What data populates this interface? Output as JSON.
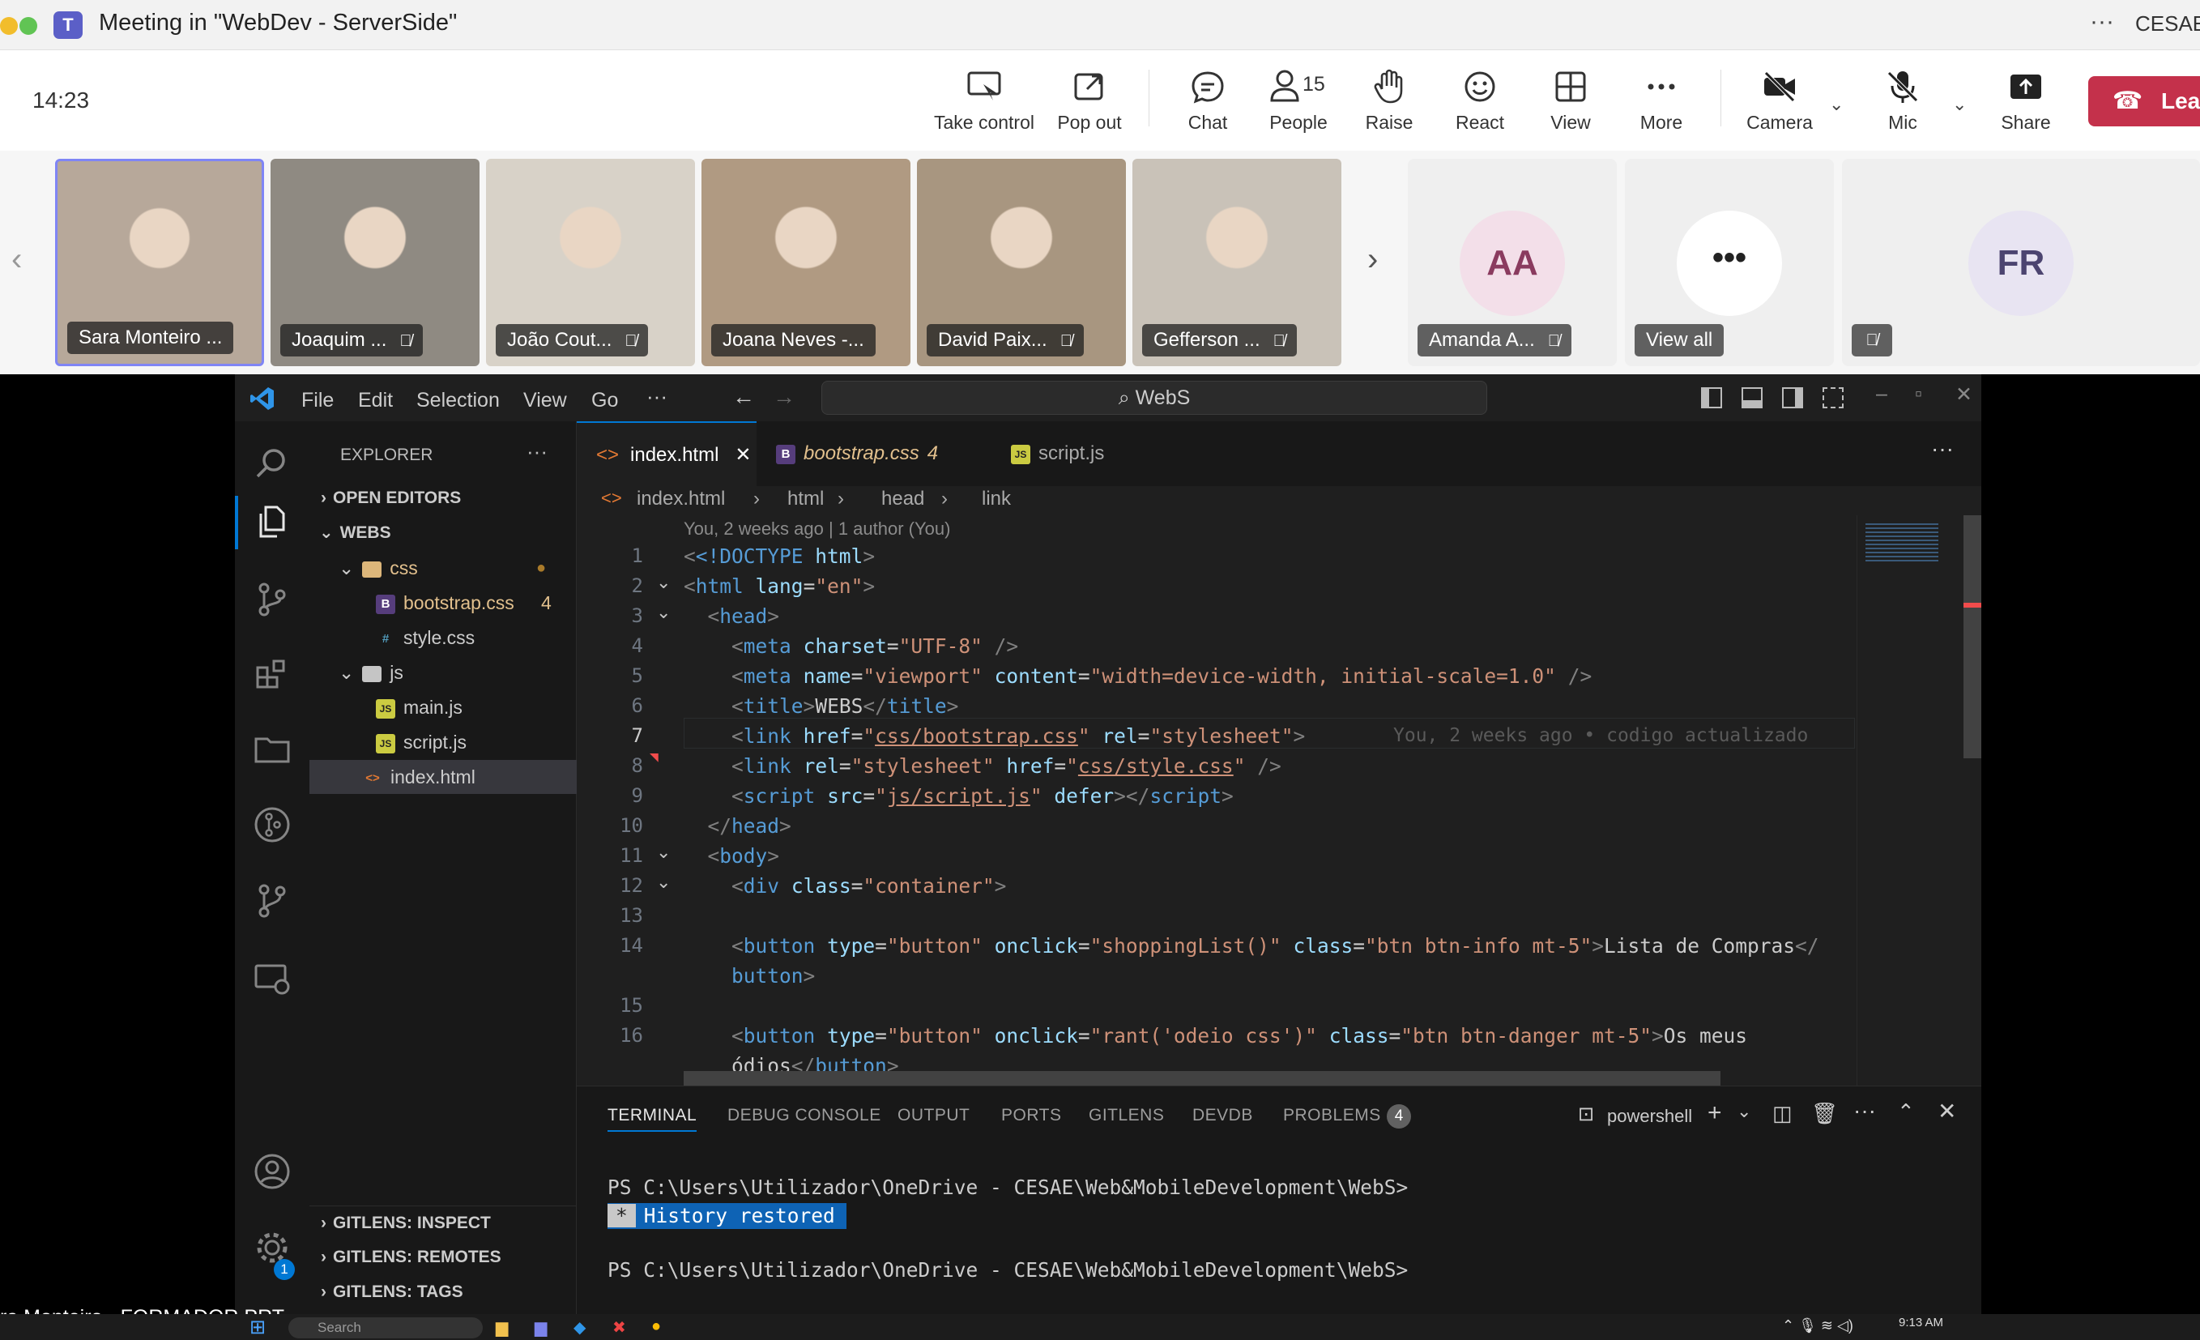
{
  "window": {
    "title": "Meeting in \"WebDev - ServerSide\"",
    "org": "CESAE"
  },
  "toolbar": {
    "time": "14:23",
    "take_control": "Take control",
    "pop_out": "Pop out",
    "chat": "Chat",
    "people": "People",
    "people_count": "15",
    "raise": "Raise",
    "react": "React",
    "view": "View",
    "more": "More",
    "camera": "Camera",
    "mic": "Mic",
    "share": "Share",
    "leave": "Leav"
  },
  "participants": [
    {
      "name": "Sara Monteiro ...",
      "bg": "#b7a89a"
    },
    {
      "name": "Joaquim ...",
      "bg": "#8f8a82"
    },
    {
      "name": "João Cout...",
      "bg": "#d8d2c8"
    },
    {
      "name": "Joana Neves -...",
      "bg": "#b09a82"
    },
    {
      "name": "David Paix...",
      "bg": "#a89680"
    },
    {
      "name": "Gefferson ...",
      "bg": "#c9c2b8"
    }
  ],
  "avatars": [
    {
      "initials": "AA",
      "name": "Amanda A...",
      "bg": "#f3dfe9",
      "fg": "#8a3b5f"
    },
    {
      "initials": "FR",
      "bg": "#e8e4f2",
      "fg": "#4c4470"
    }
  ],
  "view_all": "View all",
  "vscode": {
    "menu": [
      "File",
      "Edit",
      "Selection",
      "View",
      "Go"
    ],
    "search": "WebS",
    "explorer": {
      "title": "EXPLORER",
      "open_editors": "OPEN EDITORS",
      "workspace": "WEBS",
      "items": [
        {
          "label": "css",
          "kind": "folder"
        },
        {
          "label": "bootstrap.css",
          "badge": "4",
          "kind": "B"
        },
        {
          "label": "style.css",
          "kind": "#"
        },
        {
          "label": "js",
          "kind": "folder"
        },
        {
          "label": "main.js",
          "kind": "JS"
        },
        {
          "label": "script.js",
          "kind": "JS"
        },
        {
          "label": "index.html",
          "kind": "html"
        }
      ],
      "bottom": [
        "GITLENS: INSPECT",
        "GITLENS: REMOTES",
        "GITLENS: TAGS"
      ]
    },
    "tabs": [
      {
        "label": "index.html"
      },
      {
        "label": "bootstrap.css",
        "badge": "4"
      },
      {
        "label": "script.js"
      }
    ],
    "breadcrumb": [
      "index.html",
      "html",
      "head",
      "link"
    ],
    "blame_top": "You, 2 weeks ago | 1 author (You)",
    "blame_line": "You, 2 weeks ago • codigo actualizado",
    "line_numbers": [
      "1",
      "2",
      "3",
      "4",
      "5",
      "6",
      "7",
      "8",
      "9",
      "10",
      "11",
      "12",
      "13",
      "14",
      "",
      "15",
      "16"
    ],
    "code": {
      "l1a": "<!DOCTYPE",
      "l1b": "html",
      "l1c": ">",
      "meta": "meta",
      "charset": "charset",
      "utf8": "\"UTF-8\"",
      "name": "name",
      "viewport": "\"viewport\"",
      "content": "content",
      "contentval": "\"width=device-width, initial-scale=1.0\"",
      "webs": "WEBS",
      "bootstrap_path": "css/bootstrap.css",
      "stylesheet": "\"stylesheet\"",
      "style_path": "css/style.css",
      "script_path": "js/script.js",
      "defer": "defer",
      "container": "\"container\"",
      "shop_click": "\"shoppingList()\"",
      "cls_info": "\"btn btn-info mt-5\"",
      "lista": "Lista de Compras",
      "rant_click": "\"rant('odeio css')\"",
      "cls_danger": "\"btn btn-danger mt-5\"",
      "meus": "Os meus",
      "odios": "ódios"
    },
    "panel_tabs": [
      "TERMINAL",
      "DEBUG CONSOLE",
      "OUTPUT",
      "PORTS",
      "GITLENS",
      "DEVDB",
      "PROBLEMS"
    ],
    "problems_count": "4",
    "shell": "powershell",
    "terminal": {
      "prompt": "PS C:\\Users\\Utilizador\\OneDrive - CESAE\\Web&MobileDevelopment\\WebS>",
      "star": "*",
      "history": "History restored"
    },
    "settings_badge": "1"
  },
  "presenter": "ra Monteiro - FORMADOR PRT",
  "taskbar": {
    "search": "Search",
    "time": "9:13 AM"
  }
}
